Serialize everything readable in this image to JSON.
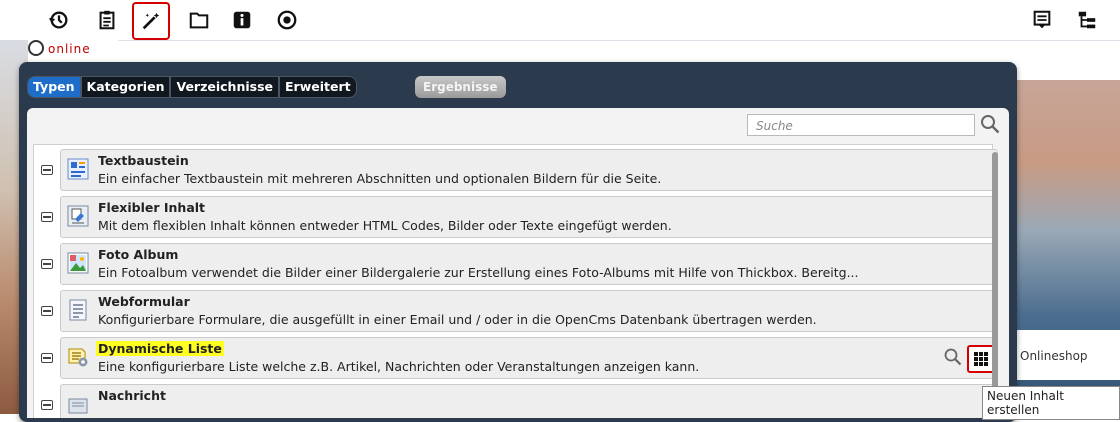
{
  "toolbar": {
    "icons": [
      "history-icon",
      "clipboard-icon",
      "magic-wand-icon",
      "folder-icon",
      "info-icon",
      "target-icon",
      "publish-list-icon",
      "sitemap-icon"
    ]
  },
  "background": {
    "online_logo": "online",
    "onlineshop": "Onlineshop"
  },
  "dialog": {
    "tabs": [
      {
        "label": "Typen",
        "selected": true
      },
      {
        "label": "Kategorien",
        "selected": false
      },
      {
        "label": "Verzeichnisse",
        "selected": false
      },
      {
        "label": "Erweitert",
        "selected": false
      }
    ],
    "results_label": "Ergebnisse",
    "search_placeholder": "Suche",
    "items": [
      {
        "title": "Textbaustein",
        "description": "Ein einfacher Textbaustein mit mehreren Abschnitten und optionalen Bildern für die Seite.",
        "icon": "text-block-icon"
      },
      {
        "title": "Flexibler Inhalt",
        "description": "Mit dem flexiblen Inhalt können entweder HTML Codes, Bilder oder Texte eingefügt werden.",
        "icon": "flexible-content-icon"
      },
      {
        "title": "Foto Album",
        "description": "Ein Fotoalbum verwendet die Bilder einer Bildergalerie zur Erstellung eines Foto-Albums mit Hilfe von Thickbox. Bereitg...",
        "icon": "photo-album-icon"
      },
      {
        "title": "Webformular",
        "description": "Konfigurierbare Formulare, die ausgefüllt in einer Email und / oder in die OpenCms Datenbank übertragen werden.",
        "icon": "web-form-icon"
      },
      {
        "title": "Dynamische Liste",
        "description": "Eine konfigurierbare Liste welche z.B. Artikel, Nachrichten oder Veranstaltungen anzeigen kann.",
        "icon": "dynamic-list-icon",
        "highlighted": true
      },
      {
        "title": "Nachricht",
        "description": "",
        "icon": "news-icon"
      }
    ],
    "tooltip": "Neuen Inhalt erstellen"
  },
  "colors": {
    "highlight": "#ffff20",
    "accent_red": "#d40000",
    "tab_selected": "#1e6ec9"
  }
}
